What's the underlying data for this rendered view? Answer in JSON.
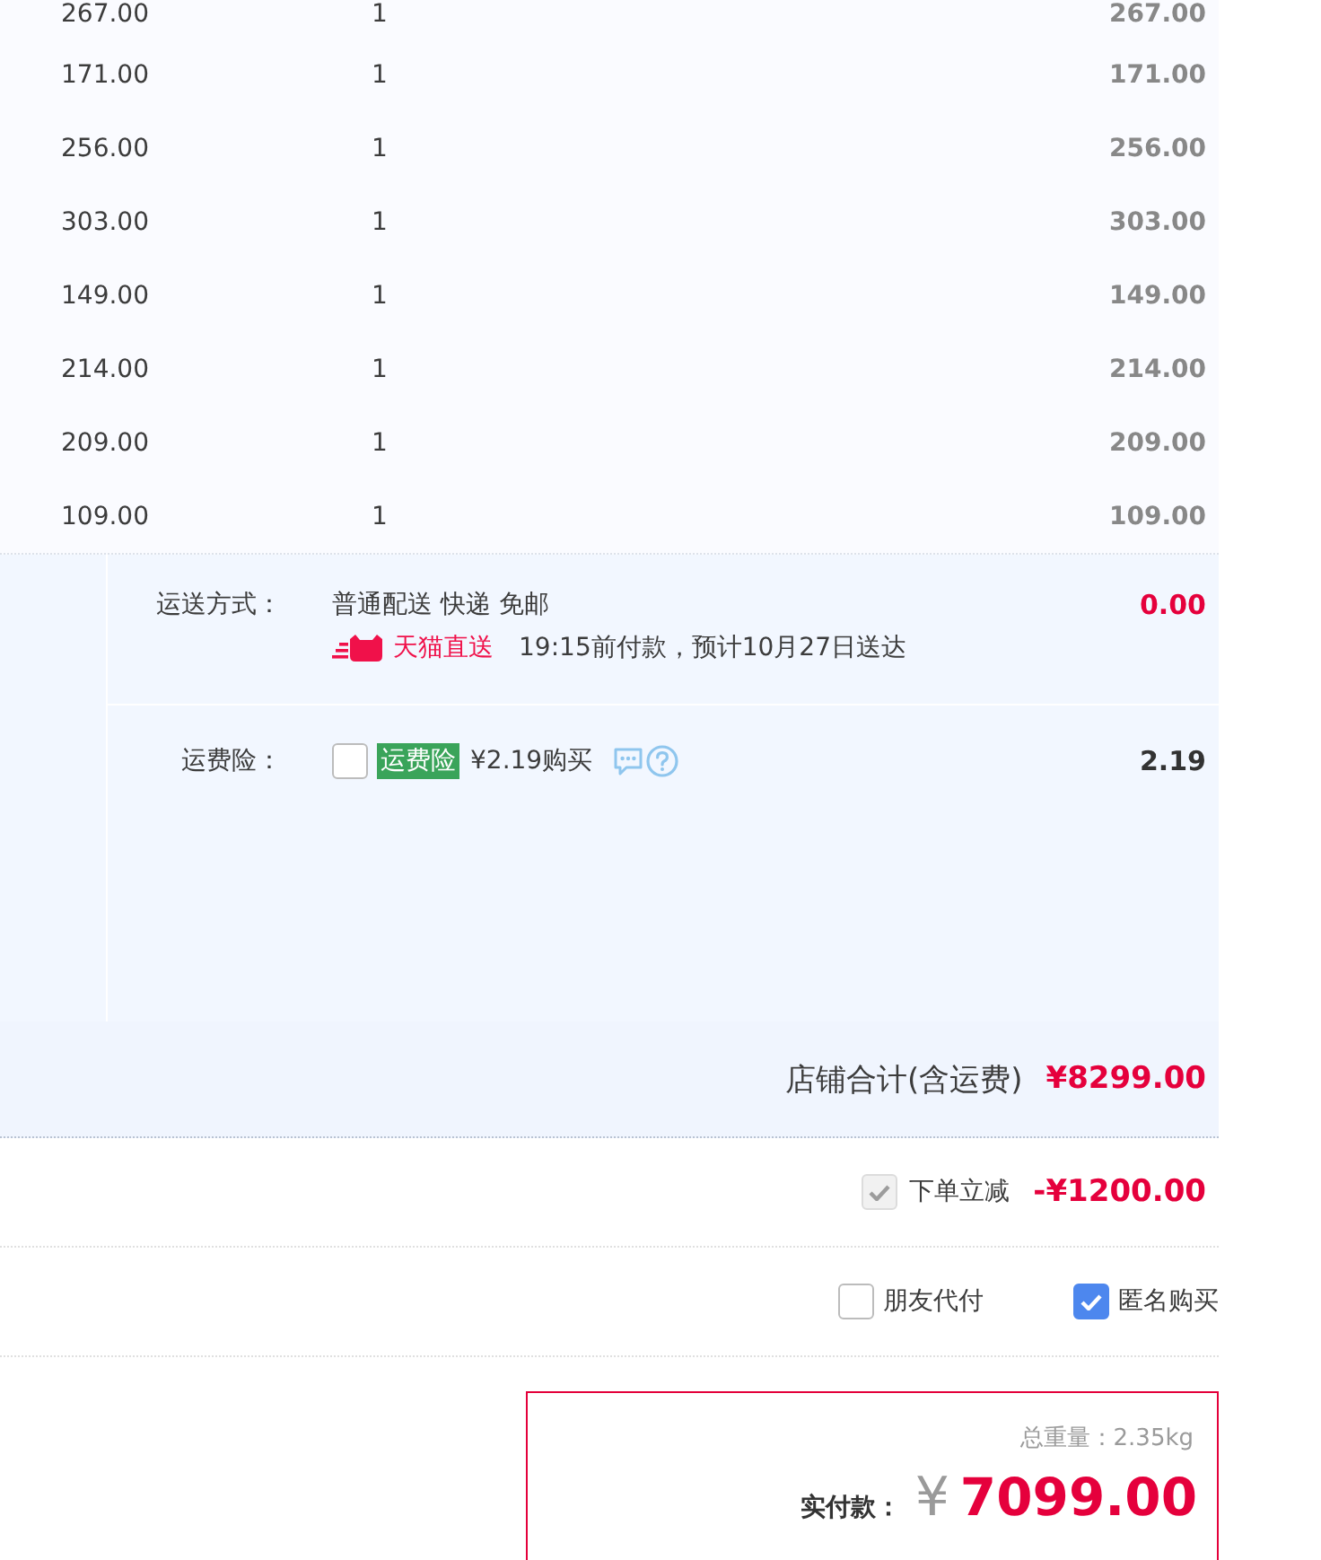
{
  "items": [
    {
      "unit_price": "267.00",
      "quantity": "1",
      "subtotal": "267.00"
    },
    {
      "unit_price": "171.00",
      "quantity": "1",
      "subtotal": "171.00"
    },
    {
      "unit_price": "256.00",
      "quantity": "1",
      "subtotal": "256.00"
    },
    {
      "unit_price": "303.00",
      "quantity": "1",
      "subtotal": "303.00"
    },
    {
      "unit_price": "149.00",
      "quantity": "1",
      "subtotal": "149.00"
    },
    {
      "unit_price": "214.00",
      "quantity": "1",
      "subtotal": "214.00"
    },
    {
      "unit_price": "209.00",
      "quantity": "1",
      "subtotal": "209.00"
    },
    {
      "unit_price": "109.00",
      "quantity": "1",
      "subtotal": "109.00"
    }
  ],
  "shipping": {
    "label": "运送方式：",
    "method": "普通配送 快递 免邮",
    "badge": "天猫直送",
    "eta": "19:15前付款，预计10月27日送达",
    "fee": "0.00"
  },
  "insurance": {
    "label": "运费险：",
    "checked": false,
    "tag": "运费险",
    "price": "¥2.19购买",
    "fee": "2.19"
  },
  "store_total": {
    "label": "店铺合计(含运费)",
    "amount": "¥8299.00"
  },
  "discount": {
    "checked": true,
    "disabled": true,
    "label": "下单立减",
    "amount": "-¥1200.00"
  },
  "options": [
    {
      "label": "朋友代付",
      "checked": false
    },
    {
      "label": "匿名购买",
      "checked": true
    }
  ],
  "payment": {
    "weight": "总重量：2.35kg",
    "label": "实付款：",
    "currency": "¥",
    "amount": "7099.00"
  }
}
